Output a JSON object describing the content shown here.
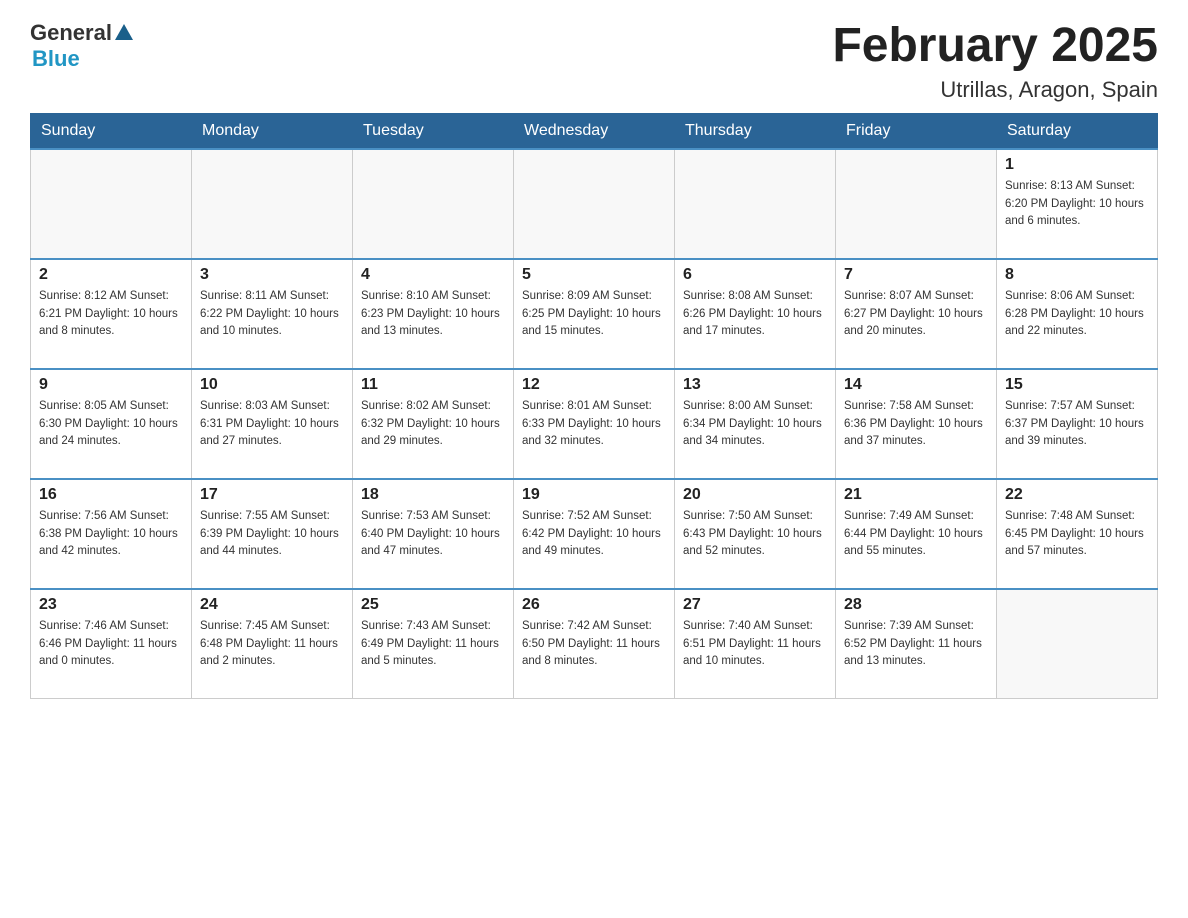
{
  "header": {
    "logo": {
      "general": "General",
      "blue": "Blue"
    },
    "month_title": "February 2025",
    "location": "Utrillas, Aragon, Spain"
  },
  "weekdays": [
    "Sunday",
    "Monday",
    "Tuesday",
    "Wednesday",
    "Thursday",
    "Friday",
    "Saturday"
  ],
  "weeks": [
    [
      {
        "day": "",
        "info": ""
      },
      {
        "day": "",
        "info": ""
      },
      {
        "day": "",
        "info": ""
      },
      {
        "day": "",
        "info": ""
      },
      {
        "day": "",
        "info": ""
      },
      {
        "day": "",
        "info": ""
      },
      {
        "day": "1",
        "info": "Sunrise: 8:13 AM\nSunset: 6:20 PM\nDaylight: 10 hours and 6 minutes."
      }
    ],
    [
      {
        "day": "2",
        "info": "Sunrise: 8:12 AM\nSunset: 6:21 PM\nDaylight: 10 hours and 8 minutes."
      },
      {
        "day": "3",
        "info": "Sunrise: 8:11 AM\nSunset: 6:22 PM\nDaylight: 10 hours and 10 minutes."
      },
      {
        "day": "4",
        "info": "Sunrise: 8:10 AM\nSunset: 6:23 PM\nDaylight: 10 hours and 13 minutes."
      },
      {
        "day": "5",
        "info": "Sunrise: 8:09 AM\nSunset: 6:25 PM\nDaylight: 10 hours and 15 minutes."
      },
      {
        "day": "6",
        "info": "Sunrise: 8:08 AM\nSunset: 6:26 PM\nDaylight: 10 hours and 17 minutes."
      },
      {
        "day": "7",
        "info": "Sunrise: 8:07 AM\nSunset: 6:27 PM\nDaylight: 10 hours and 20 minutes."
      },
      {
        "day": "8",
        "info": "Sunrise: 8:06 AM\nSunset: 6:28 PM\nDaylight: 10 hours and 22 minutes."
      }
    ],
    [
      {
        "day": "9",
        "info": "Sunrise: 8:05 AM\nSunset: 6:30 PM\nDaylight: 10 hours and 24 minutes."
      },
      {
        "day": "10",
        "info": "Sunrise: 8:03 AM\nSunset: 6:31 PM\nDaylight: 10 hours and 27 minutes."
      },
      {
        "day": "11",
        "info": "Sunrise: 8:02 AM\nSunset: 6:32 PM\nDaylight: 10 hours and 29 minutes."
      },
      {
        "day": "12",
        "info": "Sunrise: 8:01 AM\nSunset: 6:33 PM\nDaylight: 10 hours and 32 minutes."
      },
      {
        "day": "13",
        "info": "Sunrise: 8:00 AM\nSunset: 6:34 PM\nDaylight: 10 hours and 34 minutes."
      },
      {
        "day": "14",
        "info": "Sunrise: 7:58 AM\nSunset: 6:36 PM\nDaylight: 10 hours and 37 minutes."
      },
      {
        "day": "15",
        "info": "Sunrise: 7:57 AM\nSunset: 6:37 PM\nDaylight: 10 hours and 39 minutes."
      }
    ],
    [
      {
        "day": "16",
        "info": "Sunrise: 7:56 AM\nSunset: 6:38 PM\nDaylight: 10 hours and 42 minutes."
      },
      {
        "day": "17",
        "info": "Sunrise: 7:55 AM\nSunset: 6:39 PM\nDaylight: 10 hours and 44 minutes."
      },
      {
        "day": "18",
        "info": "Sunrise: 7:53 AM\nSunset: 6:40 PM\nDaylight: 10 hours and 47 minutes."
      },
      {
        "day": "19",
        "info": "Sunrise: 7:52 AM\nSunset: 6:42 PM\nDaylight: 10 hours and 49 minutes."
      },
      {
        "day": "20",
        "info": "Sunrise: 7:50 AM\nSunset: 6:43 PM\nDaylight: 10 hours and 52 minutes."
      },
      {
        "day": "21",
        "info": "Sunrise: 7:49 AM\nSunset: 6:44 PM\nDaylight: 10 hours and 55 minutes."
      },
      {
        "day": "22",
        "info": "Sunrise: 7:48 AM\nSunset: 6:45 PM\nDaylight: 10 hours and 57 minutes."
      }
    ],
    [
      {
        "day": "23",
        "info": "Sunrise: 7:46 AM\nSunset: 6:46 PM\nDaylight: 11 hours and 0 minutes."
      },
      {
        "day": "24",
        "info": "Sunrise: 7:45 AM\nSunset: 6:48 PM\nDaylight: 11 hours and 2 minutes."
      },
      {
        "day": "25",
        "info": "Sunrise: 7:43 AM\nSunset: 6:49 PM\nDaylight: 11 hours and 5 minutes."
      },
      {
        "day": "26",
        "info": "Sunrise: 7:42 AM\nSunset: 6:50 PM\nDaylight: 11 hours and 8 minutes."
      },
      {
        "day": "27",
        "info": "Sunrise: 7:40 AM\nSunset: 6:51 PM\nDaylight: 11 hours and 10 minutes."
      },
      {
        "day": "28",
        "info": "Sunrise: 7:39 AM\nSunset: 6:52 PM\nDaylight: 11 hours and 13 minutes."
      },
      {
        "day": "",
        "info": ""
      }
    ]
  ]
}
